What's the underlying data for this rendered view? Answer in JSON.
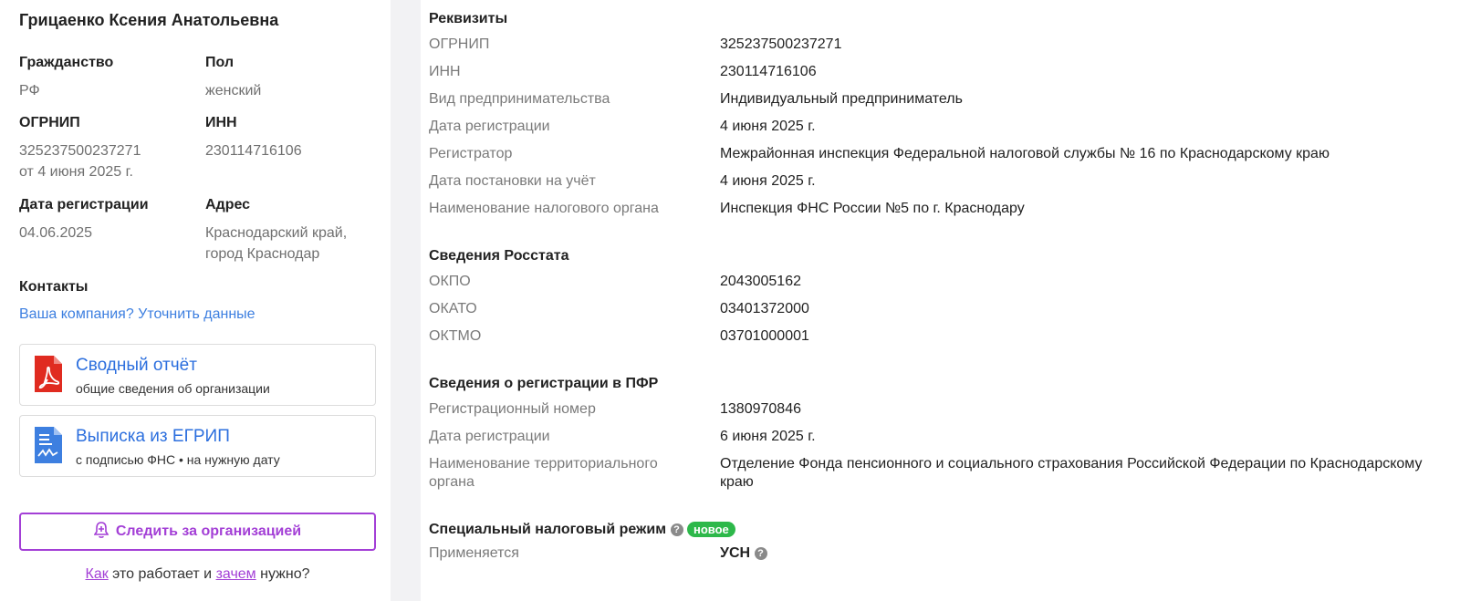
{
  "left": {
    "name": "Грицаенко Ксения Анатольевна",
    "citizenship_label": "Гражданство",
    "citizenship_value": "РФ",
    "sex_label": "Пол",
    "sex_value": "женский",
    "ogrnip_label": "ОГРНИП",
    "ogrnip_value": "325237500237271",
    "ogrnip_date": "от 4 июня 2025 г.",
    "inn_label": "ИНН",
    "inn_value": "230114716106",
    "regdate_label": "Дата регистрации",
    "regdate_value": "04.06.2025",
    "address_label": "Адрес",
    "address_line1": "Краснодарский край,",
    "address_line2": "город Краснодар",
    "contacts_label": "Контакты",
    "clarify_link": "Ваша компания? Уточнить данные",
    "card1_title": "Сводный отчёт",
    "card1_sub": "общие сведения об организации",
    "card2_title": "Выписка из ЕГРИП",
    "card2_sub": "с подписью ФНС • на нужную дату",
    "follow_label": "Следить за организацией",
    "how_link": "Как",
    "how_mid": " это работает и ",
    "why_link": "зачем",
    "how_end": " нужно?"
  },
  "right": {
    "req_title": "Реквизиты",
    "req": [
      {
        "k": "ОГРНИП",
        "v": "325237500237271"
      },
      {
        "k": "ИНН",
        "v": "230114716106"
      },
      {
        "k": "Вид предпринимательства",
        "v": "Индивидуальный предприниматель"
      },
      {
        "k": "Дата регистрации",
        "v": "4 июня 2025 г."
      },
      {
        "k": "Регистратор",
        "v": "Межрайонная инспекция Федеральной налоговой службы № 16 по Краснодарскому краю"
      },
      {
        "k": "Дата постановки на учёт",
        "v": "4 июня 2025 г."
      },
      {
        "k": "Наименование налогового органа",
        "v": "Инспекция ФНС России №5 по г. Краснодару"
      }
    ],
    "rosstat_title": "Сведения Росстата",
    "rosstat": [
      {
        "k": "ОКПО",
        "v": "2043005162"
      },
      {
        "k": "ОКАТО",
        "v": "03401372000"
      },
      {
        "k": "ОКТМО",
        "v": "03701000001"
      }
    ],
    "pfr_title": "Сведения о регистрации в ПФР",
    "pfr": [
      {
        "k": "Регистрационный номер",
        "v": "1380970846"
      },
      {
        "k": "Дата регистрации",
        "v": "6 июня 2025 г."
      },
      {
        "k": "Наименование территориального органа",
        "v": "Отделение Фонда пенсионного и социального страхования Российской Федерации по Краснодарскому краю"
      }
    ],
    "tax_title": "Специальный налоговый режим",
    "tax_badge": "новое",
    "tax_k": "Применяется",
    "tax_v": "УСН"
  },
  "colors": {
    "link_blue": "#3d7fe0",
    "accent_purple": "#a33fd6",
    "badge_green": "#2db84a",
    "pdf_red": "#e02b20",
    "doc_blue": "#3d7fe0"
  },
  "icons": [
    "pdf-icon",
    "document-icon",
    "bell-plus-icon",
    "question-icon"
  ]
}
